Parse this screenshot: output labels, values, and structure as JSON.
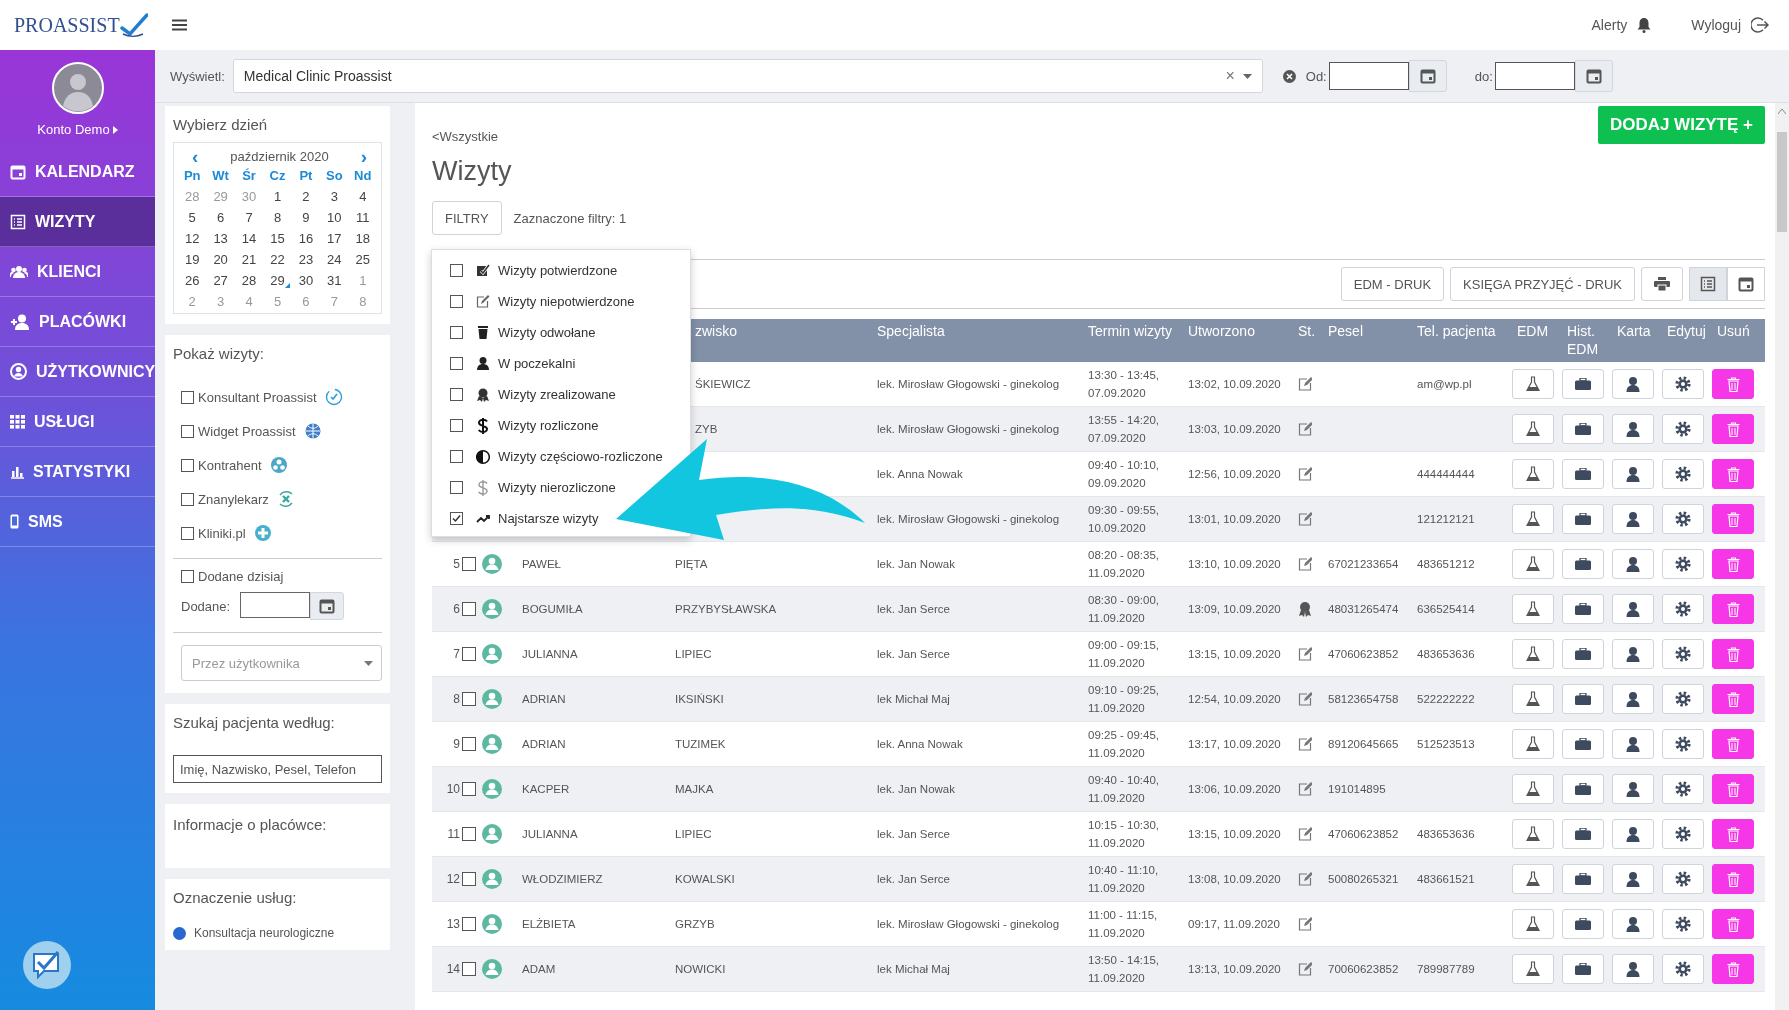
{
  "header": {
    "logo": "PROASSIST",
    "alerts": "Alerty",
    "logout": "Wyloguj"
  },
  "sidebar": {
    "user": "Konto Demo",
    "items": [
      {
        "label": "KALENDARZ",
        "kind": "calendar",
        "selected": false
      },
      {
        "label": "WIZYTY",
        "kind": "list",
        "selected": true
      },
      {
        "label": "KLIENCI",
        "kind": "group",
        "selected": false
      },
      {
        "label": "PLACÓWKI",
        "kind": "add-user",
        "selected": false
      },
      {
        "label": "UŻYTKOWNICY",
        "kind": "user-circle",
        "selected": false
      },
      {
        "label": "USŁUGI",
        "kind": "grid",
        "selected": false
      },
      {
        "label": "STATYSTYKI",
        "kind": "chart",
        "selected": false
      },
      {
        "label": "SMS",
        "kind": "phone",
        "selected": false
      }
    ]
  },
  "filter_bar": {
    "display_label": "Wyświetl:",
    "display_value": "Medical Clinic Proassist",
    "clear": "×",
    "from_label": "Od:",
    "to_label": "do:"
  },
  "calendar": {
    "title": "Wybierz dzień",
    "month": "październik 2020",
    "prev": "‹",
    "next": "›",
    "weekdays": [
      "Pn",
      "Wt",
      "Śr",
      "Cz",
      "Pt",
      "So",
      "Nd"
    ],
    "weeks": [
      [
        {
          "day": "28",
          "other_month": true,
          "marked": false
        },
        {
          "day": "29",
          "other_month": true,
          "marked": false
        },
        {
          "day": "30",
          "other_month": true,
          "marked": false
        },
        {
          "day": "1",
          "other_month": false,
          "marked": false
        },
        {
          "day": "2",
          "other_month": false,
          "marked": false
        },
        {
          "day": "3",
          "other_month": false,
          "marked": false
        },
        {
          "day": "4",
          "other_month": false,
          "marked": false
        }
      ],
      [
        {
          "day": "5",
          "other_month": false,
          "marked": false
        },
        {
          "day": "6",
          "other_month": false,
          "marked": false
        },
        {
          "day": "7",
          "other_month": false,
          "marked": false
        },
        {
          "day": "8",
          "other_month": false,
          "marked": false
        },
        {
          "day": "9",
          "other_month": false,
          "marked": false
        },
        {
          "day": "10",
          "other_month": false,
          "marked": false
        },
        {
          "day": "11",
          "other_month": false,
          "marked": false
        }
      ],
      [
        {
          "day": "12",
          "other_month": false,
          "marked": false
        },
        {
          "day": "13",
          "other_month": false,
          "marked": false
        },
        {
          "day": "14",
          "other_month": false,
          "marked": false
        },
        {
          "day": "15",
          "other_month": false,
          "marked": false
        },
        {
          "day": "16",
          "other_month": false,
          "marked": false
        },
        {
          "day": "17",
          "other_month": false,
          "marked": false
        },
        {
          "day": "18",
          "other_month": false,
          "marked": false
        }
      ],
      [
        {
          "day": "19",
          "other_month": false,
          "marked": false
        },
        {
          "day": "20",
          "other_month": false,
          "marked": false
        },
        {
          "day": "21",
          "other_month": false,
          "marked": false
        },
        {
          "day": "22",
          "other_month": false,
          "marked": false
        },
        {
          "day": "23",
          "other_month": false,
          "marked": false
        },
        {
          "day": "24",
          "other_month": false,
          "marked": false
        },
        {
          "day": "25",
          "other_month": false,
          "marked": false
        }
      ],
      [
        {
          "day": "26",
          "other_month": false,
          "marked": false
        },
        {
          "day": "27",
          "other_month": false,
          "marked": false
        },
        {
          "day": "28",
          "other_month": false,
          "marked": false
        },
        {
          "day": "29",
          "other_month": false,
          "marked": true
        },
        {
          "day": "30",
          "other_month": false,
          "marked": false
        },
        {
          "day": "31",
          "other_month": false,
          "marked": false
        },
        {
          "day": "1",
          "other_month": true,
          "marked": false
        }
      ],
      [
        {
          "day": "2",
          "other_month": true,
          "marked": false
        },
        {
          "day": "3",
          "other_month": true,
          "marked": false
        },
        {
          "day": "4",
          "other_month": true,
          "marked": false
        },
        {
          "day": "5",
          "other_month": true,
          "marked": false
        },
        {
          "day": "6",
          "other_month": true,
          "marked": false
        },
        {
          "day": "7",
          "other_month": true,
          "marked": false
        },
        {
          "day": "8",
          "other_month": true,
          "marked": false
        }
      ]
    ]
  },
  "show_visits": {
    "title": "Pokaż wizyty:",
    "sources": [
      {
        "label": "Konsultant Proassist",
        "checked": false
      },
      {
        "label": "Widget Proassist",
        "checked": false
      },
      {
        "label": "Kontrahent",
        "checked": false
      },
      {
        "label": "Znanylekarz",
        "checked": false
      },
      {
        "label": "Kliniki.pl",
        "checked": false
      }
    ],
    "added_today": {
      "label": "Dodane dzisiaj",
      "checked": false
    },
    "added_label": "Dodane:",
    "user_select": {
      "placeholder": "Przez użytkownika"
    }
  },
  "patient_search": {
    "title": "Szukaj pacjenta według:",
    "placeholder": "Imię, Nazwisko, Pesel, Telefon"
  },
  "clinic_info": {
    "title": "Informacje o placówce:"
  },
  "service_legend": {
    "title": "Oznaczenie usług:",
    "items": [
      {
        "label": "Konsultacja neurologiczne",
        "color": "#2a66d0"
      }
    ]
  },
  "main": {
    "back_link": "<Wszystkie",
    "title": "Wizyty",
    "add_button": "DODAJ WIZYTĘ +",
    "filters_button": "FILTRY",
    "filters_count": "Zaznaczone filtry: 1",
    "edm_print": "EDM - DRUK",
    "book_print": "KSIĘGA PRZYJĘĆ - DRUK",
    "views": [
      {
        "kind": "list",
        "selected": true
      },
      {
        "kind": "calendar",
        "selected": false
      }
    ]
  },
  "filter_menu": [
    {
      "label": "Wizyty potwierdzone",
      "kind": "confirmed",
      "checked": false
    },
    {
      "label": "Wizyty niepotwierdzone",
      "kind": "unconfirmed",
      "checked": false
    },
    {
      "label": "Wizyty odwołane",
      "kind": "cancelled",
      "checked": false
    },
    {
      "label": "W poczekalni",
      "kind": "waiting",
      "checked": false
    },
    {
      "label": "Wizyty zrealizowane",
      "kind": "realized",
      "checked": false
    },
    {
      "label": "Wizyty rozliczone",
      "kind": "settled",
      "checked": false
    },
    {
      "label": "Wizyty częściowo-rozliczone",
      "kind": "partial",
      "checked": false
    },
    {
      "label": "Wizyty nierozliczone",
      "kind": "unsettled",
      "checked": false
    },
    {
      "label": "Najstarsze wizyty",
      "kind": "oldest",
      "checked": true
    }
  ],
  "table": {
    "columns": [
      "zwisko",
      "Specjalista",
      "Termin wizyty",
      "Utworzono",
      "St.",
      "Pesel",
      "Tel. pacjenta",
      "EDM",
      "Hist. EDM",
      "Karta",
      "Edytuj",
      "Usuń"
    ],
    "rows": [
      {
        "surname": "ŚKIEWICZ",
        "specialist": "lek. Mirosław Głogowski - ginekolog",
        "term": "13:30 - 13:45,",
        "term_date": "07.09.2020",
        "created": "13:02, 10.09.2020",
        "kind": "unconfirmed",
        "phone": "am@wp.pl"
      },
      {
        "surname": "ZYB",
        "specialist": "lek. Mirosław Głogowski - ginekolog",
        "term": "13:55 - 14:20,",
        "term_date": "07.09.2020",
        "created": "13:03, 10.09.2020",
        "kind": "unconfirmed"
      },
      {
        "specialist": "lek. Anna Nowak",
        "term": "09:40 - 10:10,",
        "term_date": "09.09.2020",
        "created": "12:56, 10.09.2020",
        "kind": "unconfirmed",
        "phone": "444444444"
      },
      {
        "specialist": "lek. Mirosław Głogowski - ginekolog",
        "term": "09:30 - 09:55,",
        "term_date": "10.09.2020",
        "created": "13:01, 10.09.2020",
        "kind": "unconfirmed",
        "phone": "121212121"
      },
      {
        "number": "5",
        "selected": false,
        "first_name": "PAWEŁ",
        "surname": "PIĘTA",
        "specialist": "lek. Jan Nowak",
        "term": "08:20 - 08:35,",
        "term_date": "11.09.2020",
        "created": "13:10, 10.09.2020",
        "kind": "unconfirmed",
        "pesel": "67021233654",
        "phone": "483651212"
      },
      {
        "number": "6",
        "selected": false,
        "first_name": "BOGUMIŁA",
        "surname": "PRZYBYSŁAWSKA",
        "specialist": "lek. Jan Serce",
        "term": "08:30 - 09:00,",
        "term_date": "11.09.2020",
        "created": "13:09, 10.09.2020",
        "kind": "realized",
        "pesel": "48031265474",
        "phone": "636525414"
      },
      {
        "number": "7",
        "selected": false,
        "first_name": "JULIANNA",
        "surname": "LIPIEC",
        "specialist": "lek. Jan Serce",
        "term": "09:00 - 09:15,",
        "term_date": "11.09.2020",
        "created": "13:15, 10.09.2020",
        "kind": "unconfirmed",
        "pesel": "47060623852",
        "phone": "483653636"
      },
      {
        "number": "8",
        "selected": false,
        "first_name": "ADRIAN",
        "surname": "IKSIŃSKI",
        "specialist": "lek Michał Maj",
        "term": "09:10 - 09:25,",
        "term_date": "11.09.2020",
        "created": "12:54, 10.09.2020",
        "kind": "unconfirmed",
        "pesel": "58123654758",
        "phone": "522222222"
      },
      {
        "number": "9",
        "selected": false,
        "first_name": "ADRIAN",
        "surname": "TUZIMEK",
        "specialist": "lek. Anna Nowak",
        "term": "09:25 - 09:45,",
        "term_date": "11.09.2020",
        "created": "13:17, 10.09.2020",
        "kind": "unconfirmed",
        "pesel": "89120645665",
        "phone": "512523513"
      },
      {
        "number": "10",
        "selected": false,
        "first_name": "KACPER",
        "surname": "MAJKA",
        "specialist": "lek. Jan Nowak",
        "term": "09:40 - 10:40,",
        "term_date": "11.09.2020",
        "created": "13:06, 10.09.2020",
        "kind": "unconfirmed",
        "pesel": "191014895"
      },
      {
        "number": "11",
        "selected": false,
        "first_name": "JULIANNA",
        "surname": "LIPIEC",
        "specialist": "lek. Jan Serce",
        "term": "10:15 - 10:30,",
        "term_date": "11.09.2020",
        "created": "13:15, 10.09.2020",
        "kind": "unconfirmed",
        "pesel": "47060623852",
        "phone": "483653636"
      },
      {
        "number": "12",
        "selected": false,
        "first_name": "WŁODZIMIERZ",
        "surname": "KOWALSKI",
        "specialist": "lek. Jan Serce",
        "term": "10:40 - 11:10,",
        "term_date": "11.09.2020",
        "created": "13:08, 10.09.2020",
        "kind": "unconfirmed",
        "pesel": "50080265321",
        "phone": "483661521"
      },
      {
        "number": "13",
        "selected": false,
        "first_name": "ELŻBIETA",
        "surname": "GRZYB",
        "specialist": "lek. Mirosław Głogowski - ginekolog",
        "term": "11:00 - 11:15,",
        "term_date": "11.09.2020",
        "created": "09:17, 11.09.2020",
        "kind": "unconfirmed"
      },
      {
        "number": "14",
        "selected": false,
        "first_name": "ADAM",
        "surname": "NOWICKI",
        "specialist": "lek Michał Maj",
        "term": "13:50 - 14:15,",
        "term_date": "11.09.2020",
        "created": "13:13, 10.09.2020",
        "kind": "unconfirmed",
        "pesel": "70060623852",
        "phone": "789987789"
      }
    ]
  }
}
